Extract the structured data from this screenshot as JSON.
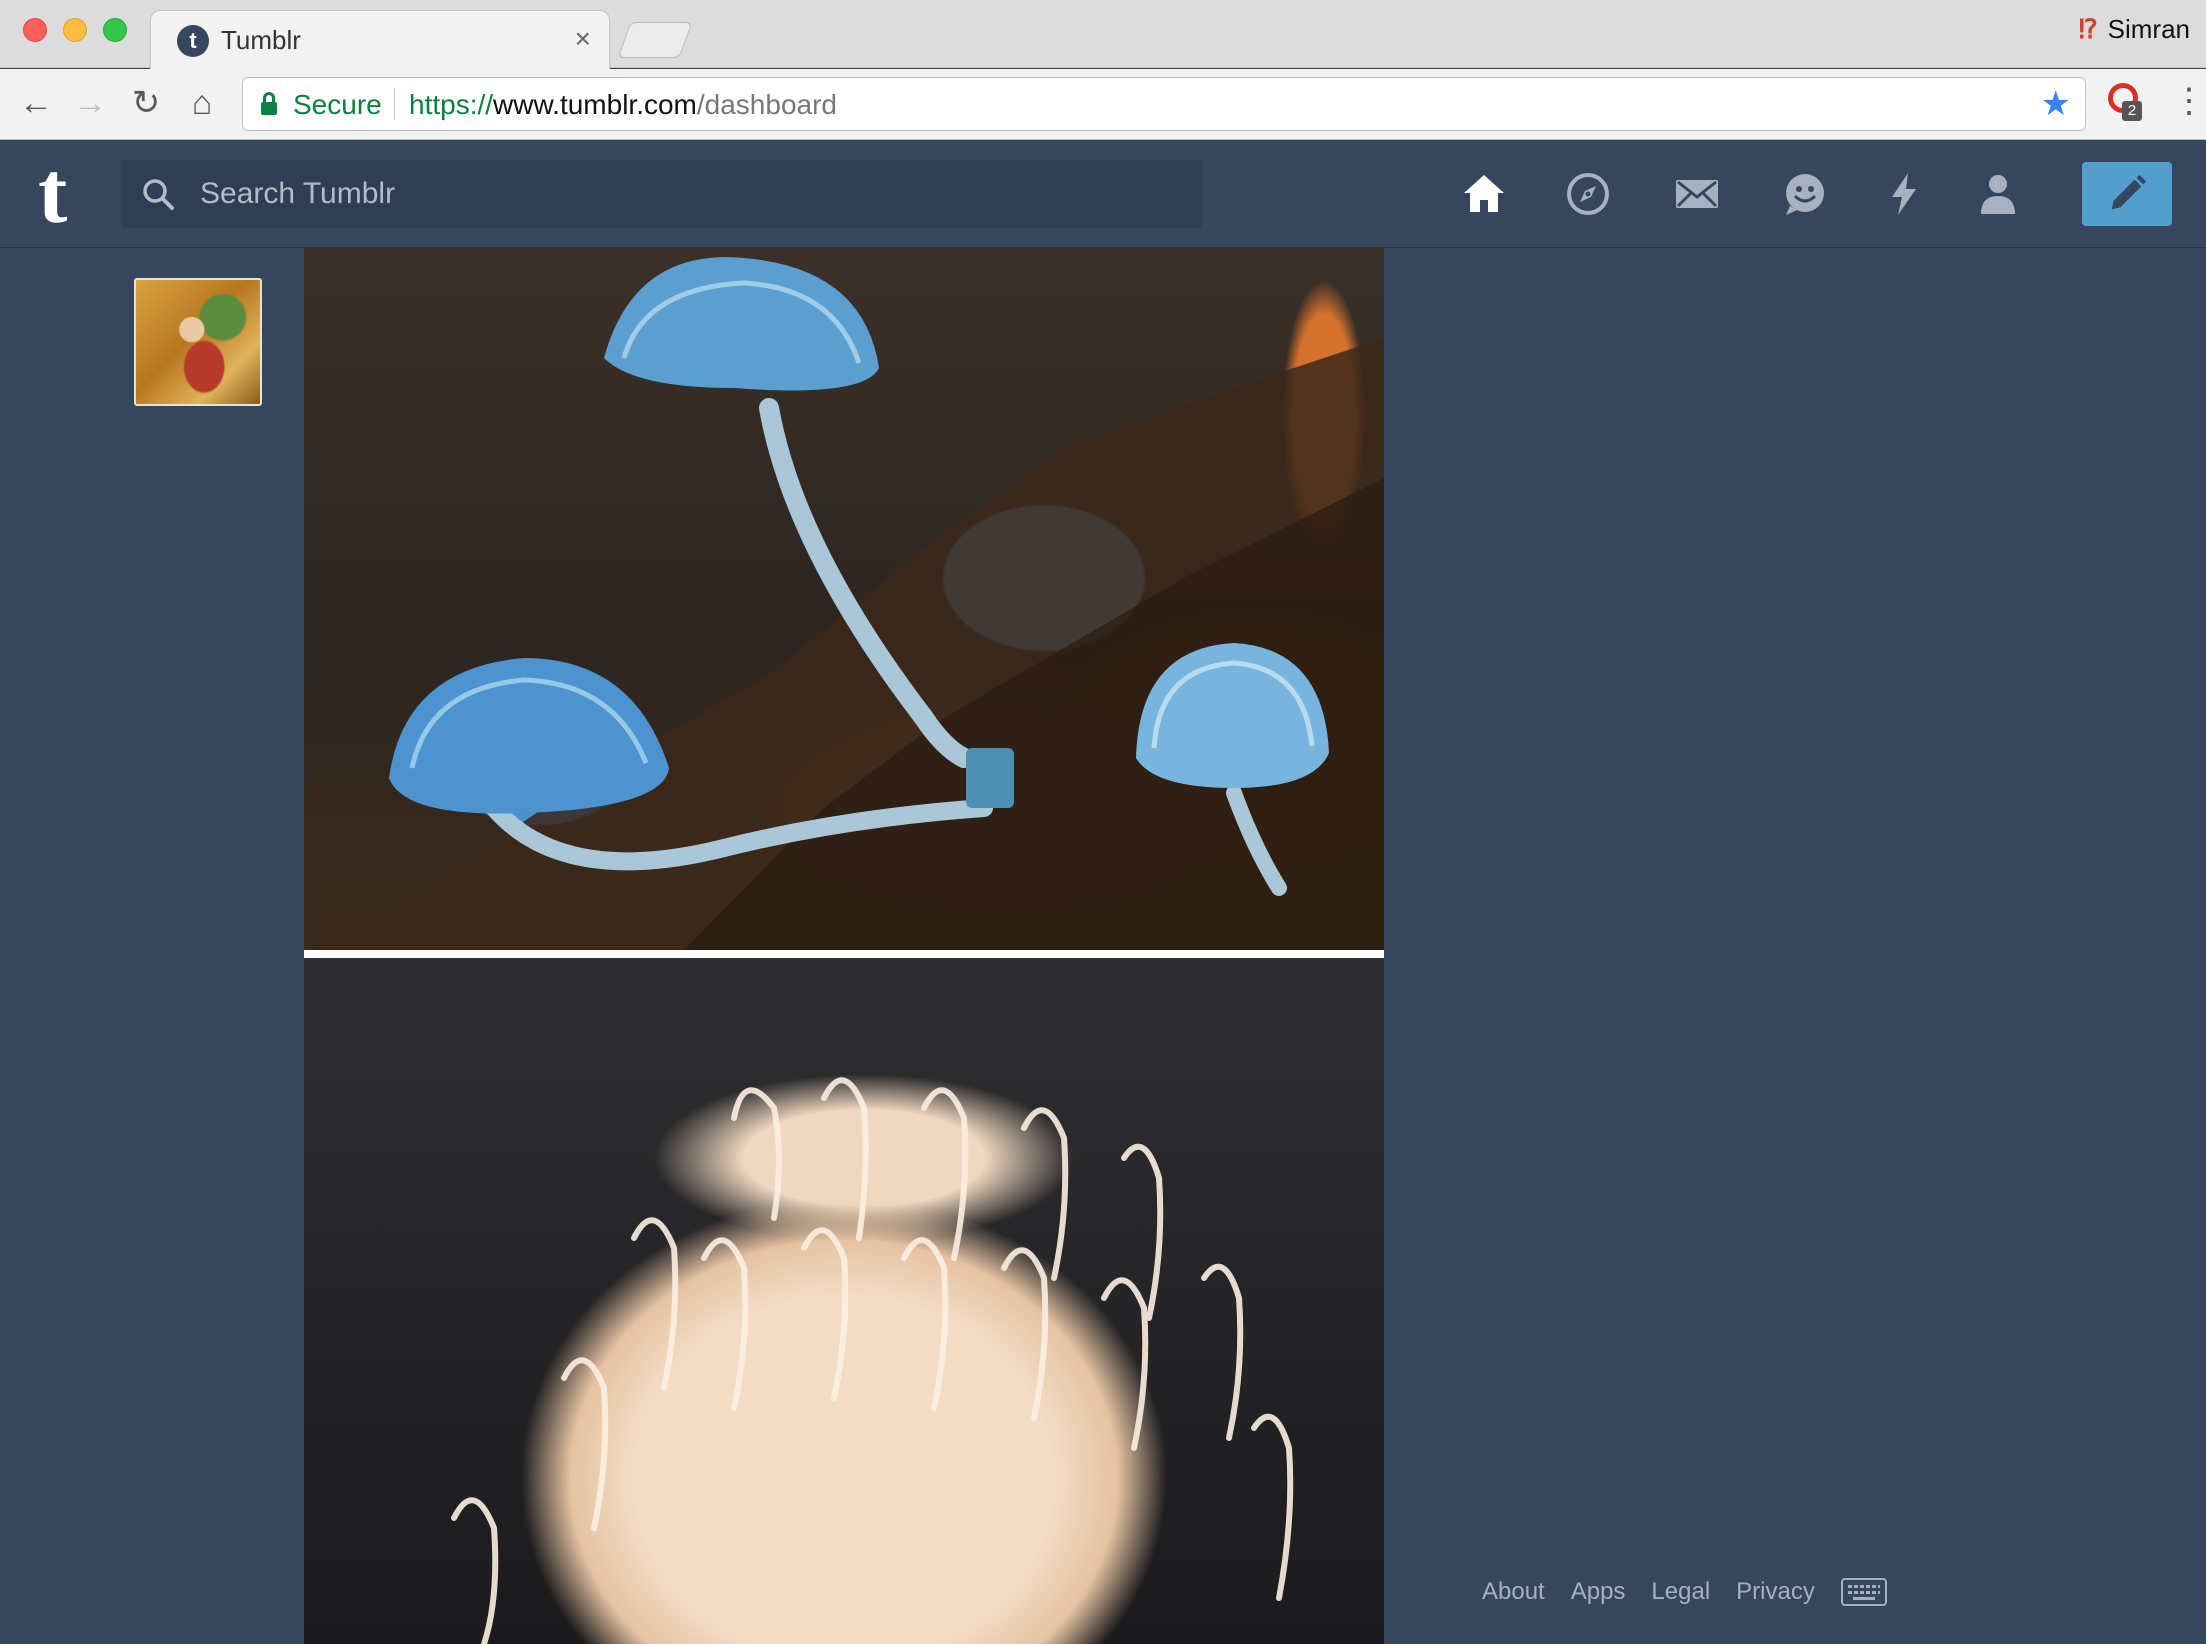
{
  "browser": {
    "tab_title": "Tumblr",
    "tab_favicon": "t",
    "profile_name": "Simran",
    "address": {
      "secure_label": "Secure",
      "url_scheme": "https://",
      "url_host": "www.tumblr.com",
      "url_path": "/dashboard"
    },
    "extension_badge": "2"
  },
  "header": {
    "logo": "t",
    "search_placeholder": "Search Tumblr",
    "nav_icons": [
      "home-icon",
      "explore-icon",
      "inbox-icon",
      "messaging-icon",
      "activity-icon",
      "account-icon"
    ],
    "compose_icon": "pencil-icon"
  },
  "footer": {
    "links": [
      "About",
      "Apps",
      "Legal",
      "Privacy"
    ]
  },
  "colors": {
    "background": "#36465d",
    "accent": "#529ecc"
  }
}
